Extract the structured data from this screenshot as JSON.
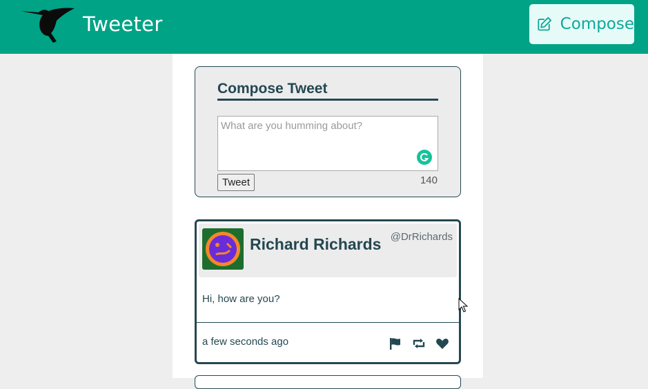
{
  "navbar": {
    "brand": "Tweeter",
    "logo_icon": "hummingbird-icon",
    "compose_label": "Compose",
    "compose_icon": "edit-icon",
    "background": "#00a386"
  },
  "compose": {
    "title": "Compose Tweet",
    "placeholder": "What are you humming about?",
    "value": "",
    "button_label": "Tweet",
    "counter": "140",
    "grammarly_icon": "grammarly-icon"
  },
  "tweets": [
    {
      "name": "Richard Richards",
      "handle": "@DrRichards",
      "content": "Hi, how are you?",
      "timestamp": "a few seconds ago",
      "actions": [
        "flag-icon",
        "retweet-icon",
        "heart-icon"
      ]
    }
  ],
  "colors": {
    "primary": "#00a386",
    "text": "#244751",
    "compose_button_bg": "#e6fbf8",
    "page_bg": "#eeeeee"
  }
}
